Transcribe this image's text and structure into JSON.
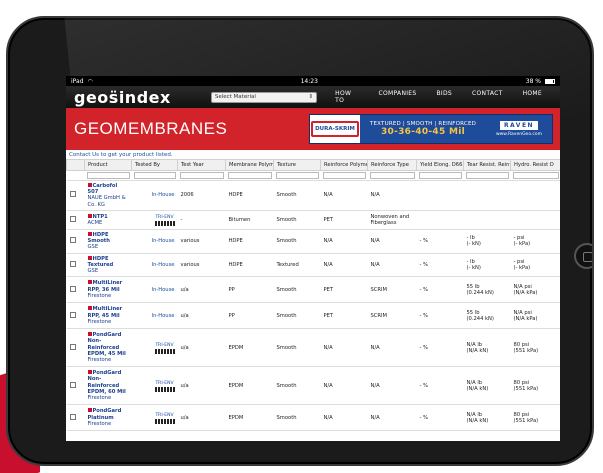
{
  "status": {
    "left": "iPad",
    "time": "14:23",
    "battery": "38 %"
  },
  "nav": {
    "logo": "geos̈index",
    "select_placeholder": "Select Material",
    "links": [
      "HOW TO",
      "COMPANIES",
      "BIDS",
      "CONTACT",
      "HOME"
    ]
  },
  "banner": {
    "title": "GEOMEMBRANES",
    "ad": {
      "logo_text": "DURA-SKRIM",
      "line1": "TEXTURED | SMOOTH | REINFORCED",
      "line2": "30-36-40-45 Mil",
      "brand": "RAVEN",
      "url": "www.RavenGeo.com"
    }
  },
  "contact_line": "Contact Us to get your product listed.",
  "table": {
    "headers": [
      "",
      "Product",
      "Tested By",
      "Test Year",
      "Membrane Polym",
      "Texture",
      "Reinforce Polyme",
      "Reinforce Type",
      "Yield Elong. D66",
      "Tear Resist. Reinf",
      "Hydro. Resist D"
    ],
    "rows": [
      {
        "name": "Carbofol 507",
        "maker": "NAUE GmbH & Co. KG",
        "tested_by": "In-House",
        "year": "2006",
        "membrane": "HDPE",
        "texture": "Smooth",
        "reinf_poly": "N/A",
        "reinf_type": "N/A",
        "yield": "",
        "tear": "",
        "hydro": ""
      },
      {
        "name": "NTP1",
        "maker": "ACME",
        "tested_by": "TRI-ENV",
        "year": "-",
        "membrane": "Bitumen",
        "texture": "Smooth",
        "reinf_poly": "PET",
        "reinf_type": "Nonwoven and Fiberglass",
        "yield": "",
        "tear": "",
        "hydro": ""
      },
      {
        "name": "HDPE Smooth",
        "maker": "GSE",
        "tested_by": "In-House",
        "year": "various",
        "membrane": "HDPE",
        "texture": "Smooth",
        "reinf_poly": "N/A",
        "reinf_type": "N/A",
        "yield": "- %",
        "tear": "- lb\n(- kN)",
        "hydro": "- psi\n(- kPa)"
      },
      {
        "name": "HDPE Textured",
        "maker": "GSE",
        "tested_by": "In-House",
        "year": "various",
        "membrane": "HDPE",
        "texture": "Textured",
        "reinf_poly": "N/A",
        "reinf_type": "N/A",
        "yield": "- %",
        "tear": "- lb\n(- kN)",
        "hydro": "- psi\n(- kPa)"
      },
      {
        "name": "MultiLiner RPP, 36 Mil",
        "maker": "Firestone",
        "tested_by": "In-House",
        "year": "u/a",
        "membrane": "PP",
        "texture": "Smooth",
        "reinf_poly": "PET",
        "reinf_type": "SCRIM",
        "yield": "- %",
        "tear": "55 lb\n(0.244 kN)",
        "hydro": "N/A psi\n(N/A kPa)"
      },
      {
        "name": "MultiLiner RPP, 45 Mil",
        "maker": "Firestone",
        "tested_by": "In-House",
        "year": "u/a",
        "membrane": "PP",
        "texture": "Smooth",
        "reinf_poly": "PET",
        "reinf_type": "SCRIM",
        "yield": "- %",
        "tear": "55 lb\n(0.244 kN)",
        "hydro": "N/A psi\n(N/A kPa)"
      },
      {
        "name": "PondGard Non-Reinforced EPDM, 45 Mil",
        "maker": "Firestone",
        "tested_by": "TRI-ENV",
        "year": "u/a",
        "membrane": "EPDM",
        "texture": "Smooth",
        "reinf_poly": "N/A",
        "reinf_type": "N/A",
        "yield": "- %",
        "tear": "N/A lb\n(N/A kN)",
        "hydro": "80 psi\n(551 kPa)"
      },
      {
        "name": "PondGard Non-Reinforced EPDM, 60 Mil",
        "maker": "Firestone",
        "tested_by": "TRI-ENV",
        "year": "u/a",
        "membrane": "EPDM",
        "texture": "Smooth",
        "reinf_poly": "N/A",
        "reinf_type": "N/A",
        "yield": "- %",
        "tear": "N/A lb\n(N/A kN)",
        "hydro": "80 psi\n(551 kPa)"
      },
      {
        "name": "PondGard Platinum",
        "maker": "Firestone",
        "tested_by": "TRI-ENV",
        "year": "u/a",
        "membrane": "EPDM",
        "texture": "Smooth",
        "reinf_poly": "N/A",
        "reinf_type": "N/A",
        "yield": "- %",
        "tear": "N/A lb\n(N/A kN)",
        "hydro": "80 psi\n(551 kPa)"
      }
    ]
  },
  "colors": {
    "banner_red": "#d2232a",
    "link_blue": "#1a4fa0",
    "ad_blue": "#1e4b9a"
  }
}
